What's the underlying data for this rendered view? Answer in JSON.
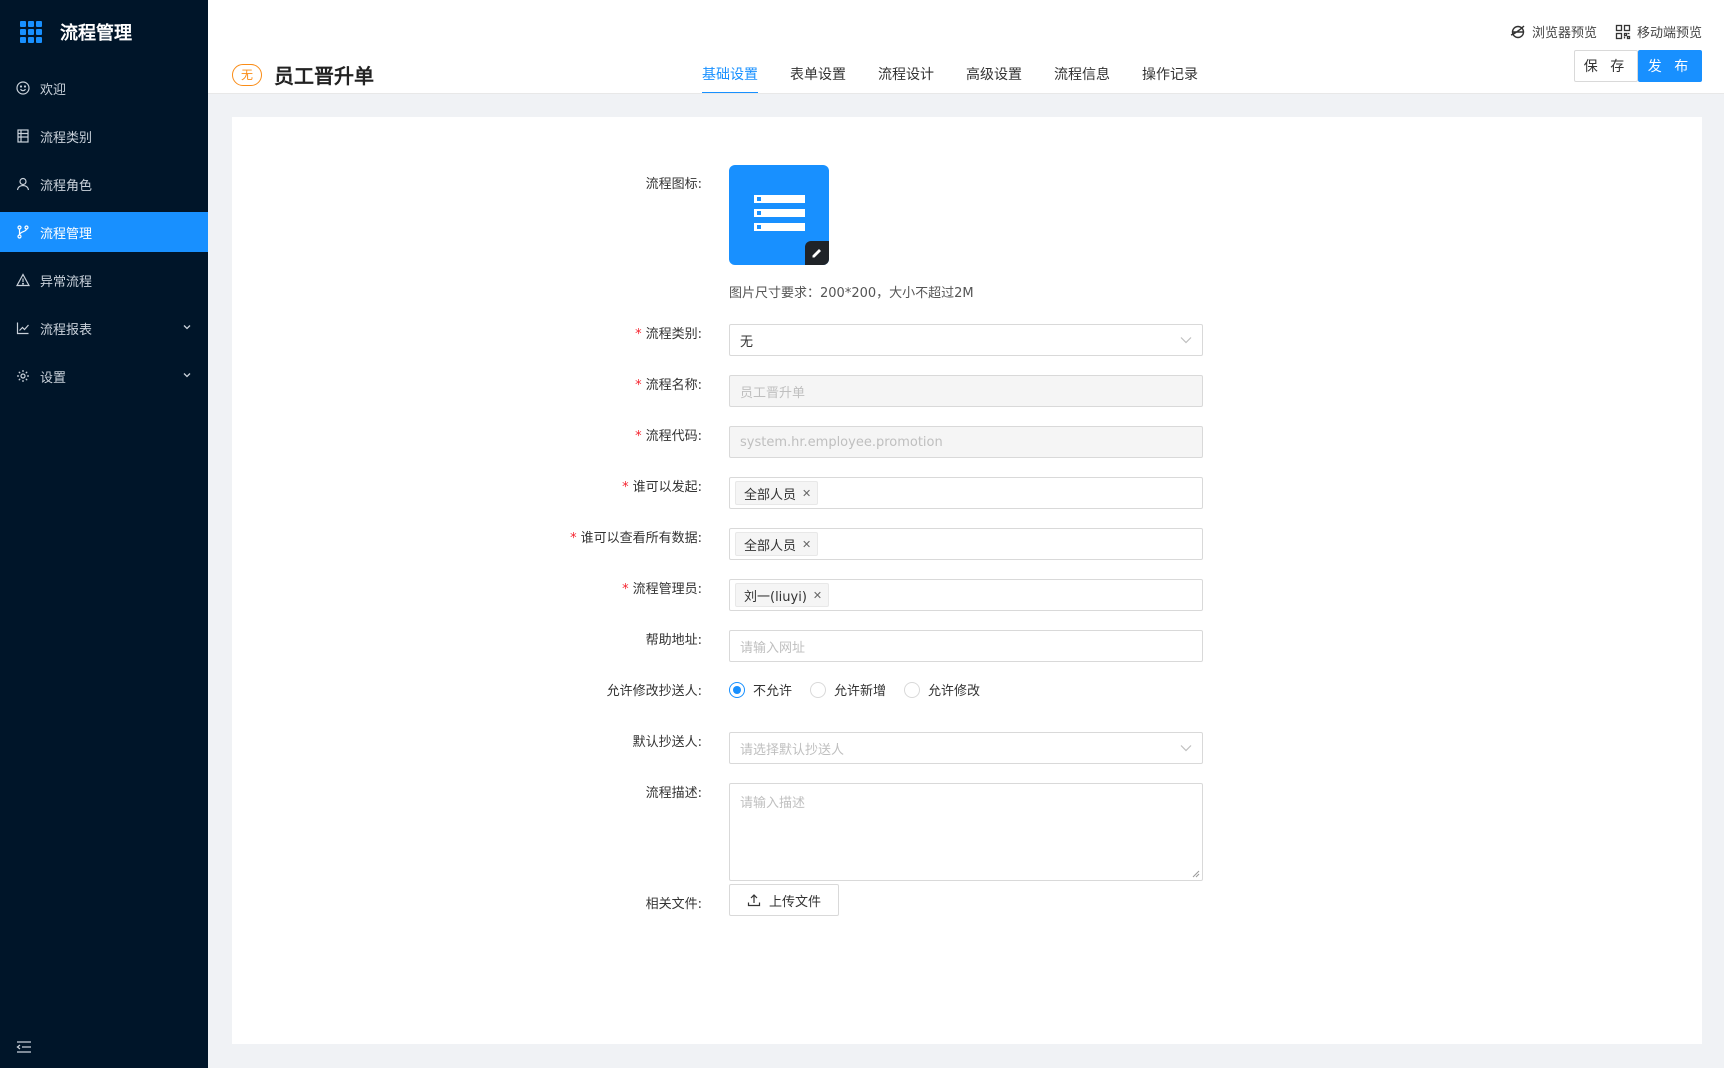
{
  "brand": {
    "title": "流程管理"
  },
  "sidebar": {
    "items": [
      {
        "label": "欢迎",
        "icon": "smile-icon"
      },
      {
        "label": "流程类别",
        "icon": "list-icon"
      },
      {
        "label": "流程角色",
        "icon": "user-icon"
      },
      {
        "label": "流程管理",
        "icon": "branch-icon",
        "active": true
      },
      {
        "label": "异常流程",
        "icon": "warning-icon"
      },
      {
        "label": "流程报表",
        "icon": "line-chart-icon",
        "expandable": true
      },
      {
        "label": "设置",
        "icon": "gear-icon",
        "expandable": true
      }
    ]
  },
  "header": {
    "badge": "无",
    "title": "员工晋升单",
    "tabs": [
      "基础设置",
      "表单设置",
      "流程设计",
      "高级设置",
      "流程信息",
      "操作记录"
    ],
    "active_tab": "基础设置",
    "browser_preview": "浏览器预览",
    "mobile_preview": "移动端预览",
    "save_label": "保 存",
    "publish_label": "发 布"
  },
  "form": {
    "icon_label": "流程图标:",
    "icon_hint": "图片尺寸要求：200*200，大小不超过2M",
    "category": {
      "label": "流程类别:",
      "value": "无"
    },
    "name": {
      "label": "流程名称:",
      "value": "员工晋升单"
    },
    "code": {
      "label": "流程代码:",
      "value": "system.hr.employee.promotion"
    },
    "initiators": {
      "label": "谁可以发起:",
      "tag": "全部人员"
    },
    "viewers": {
      "label": "谁可以查看所有数据:",
      "tag": "全部人员"
    },
    "admins": {
      "label": "流程管理员:",
      "tag": "刘一(liuyi)"
    },
    "help_url": {
      "label": "帮助地址:",
      "placeholder": "请输入网址"
    },
    "cc_modify": {
      "label": "允许修改抄送人:",
      "options": [
        "不允许",
        "允许新增",
        "允许修改"
      ],
      "selected": "不允许"
    },
    "default_cc": {
      "label": "默认抄送人:",
      "placeholder": "请选择默认抄送人"
    },
    "description": {
      "label": "流程描述:",
      "placeholder": "请输入描述"
    },
    "files": {
      "label": "相关文件:",
      "button": "上传文件"
    }
  },
  "colors": {
    "primary": "#1890ff",
    "sidebar_bg": "#001529",
    "required": "#f5222d",
    "badge": "#fa8c16"
  }
}
